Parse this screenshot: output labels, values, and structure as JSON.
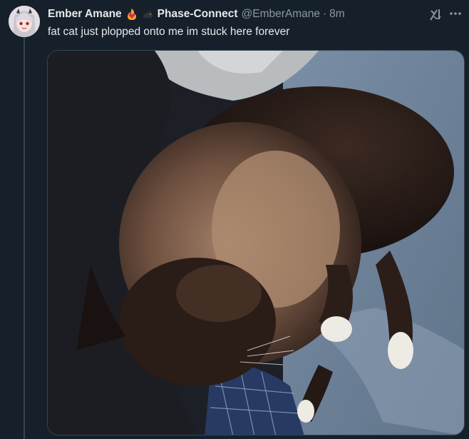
{
  "tweet": {
    "display_name": "Ember Amane",
    "affiliation": "Phase-Connect",
    "handle": "@EmberAmane",
    "separator": "·",
    "time": "8m",
    "text": "fat cat just plopped onto me im stuck here forever"
  },
  "icons": {
    "emoji_1": "fire-heart-emoji",
    "emoji_2": "black-cat-emoji",
    "grok": "grok-icon",
    "more": "more-dots-icon"
  },
  "colors": {
    "background": "#15202b",
    "text": "#e7e9ea",
    "muted": "#8b98a5"
  }
}
